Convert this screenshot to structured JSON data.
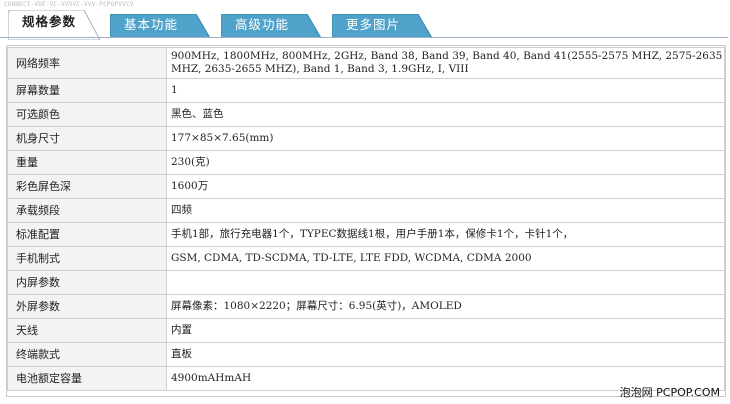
{
  "watermark": "CONNECT-VUE-VC-VVVVC-VVV-PCPOPVVCV",
  "tabs": [
    {
      "label": "规格参数",
      "active": true
    },
    {
      "label": "基本功能",
      "active": false
    },
    {
      "label": "高级功能",
      "active": false
    },
    {
      "label": "更多图片",
      "active": false
    }
  ],
  "specs": [
    {
      "key": "网络频率",
      "value": "900MHz, 1800MHz, 800MHz, 2GHz, Band 38, Band 39, Band 40, Band 41(2555-2575 MHZ, 2575-2635 MHZ, 2635-2655 MHZ), Band 1, Band 3, 1.9GHz, I, VIII"
    },
    {
      "key": "屏幕数量",
      "value": "1"
    },
    {
      "key": "可选颜色",
      "value": "黑色、蓝色"
    },
    {
      "key": "机身尺寸",
      "value": "177×85×7.65(mm)"
    },
    {
      "key": "重量",
      "value": "230(克)"
    },
    {
      "key": "彩色屏色深",
      "value": "1600万"
    },
    {
      "key": "承载频段",
      "value": "四频"
    },
    {
      "key": "标准配置",
      "value": "手机1部，旅行充电器1个，TYPEC数据线1根，用户手册1本，保修卡1个，卡针1个，"
    },
    {
      "key": "手机制式",
      "value": "GSM, CDMA, TD-SCDMA, TD-LTE, LTE FDD, WCDMA, CDMA 2000"
    },
    {
      "key": "内屏参数",
      "value": ""
    },
    {
      "key": "外屏参数",
      "value": "屏幕像素：1080×2220；屏幕尺寸：6.95(英寸)，AMOLED"
    },
    {
      "key": "天线",
      "value": "内置"
    },
    {
      "key": "终端款式",
      "value": "直板"
    },
    {
      "key": "电池额定容量",
      "value": "4900mAHmAH"
    }
  ],
  "credit": "泡泡网 PCPOP.COM",
  "colors": {
    "tab_inactive": "#4fa2c9",
    "tab_active": "#ffffff",
    "label_bg": "#f3f3f3",
    "border": "#cfcfcf"
  }
}
